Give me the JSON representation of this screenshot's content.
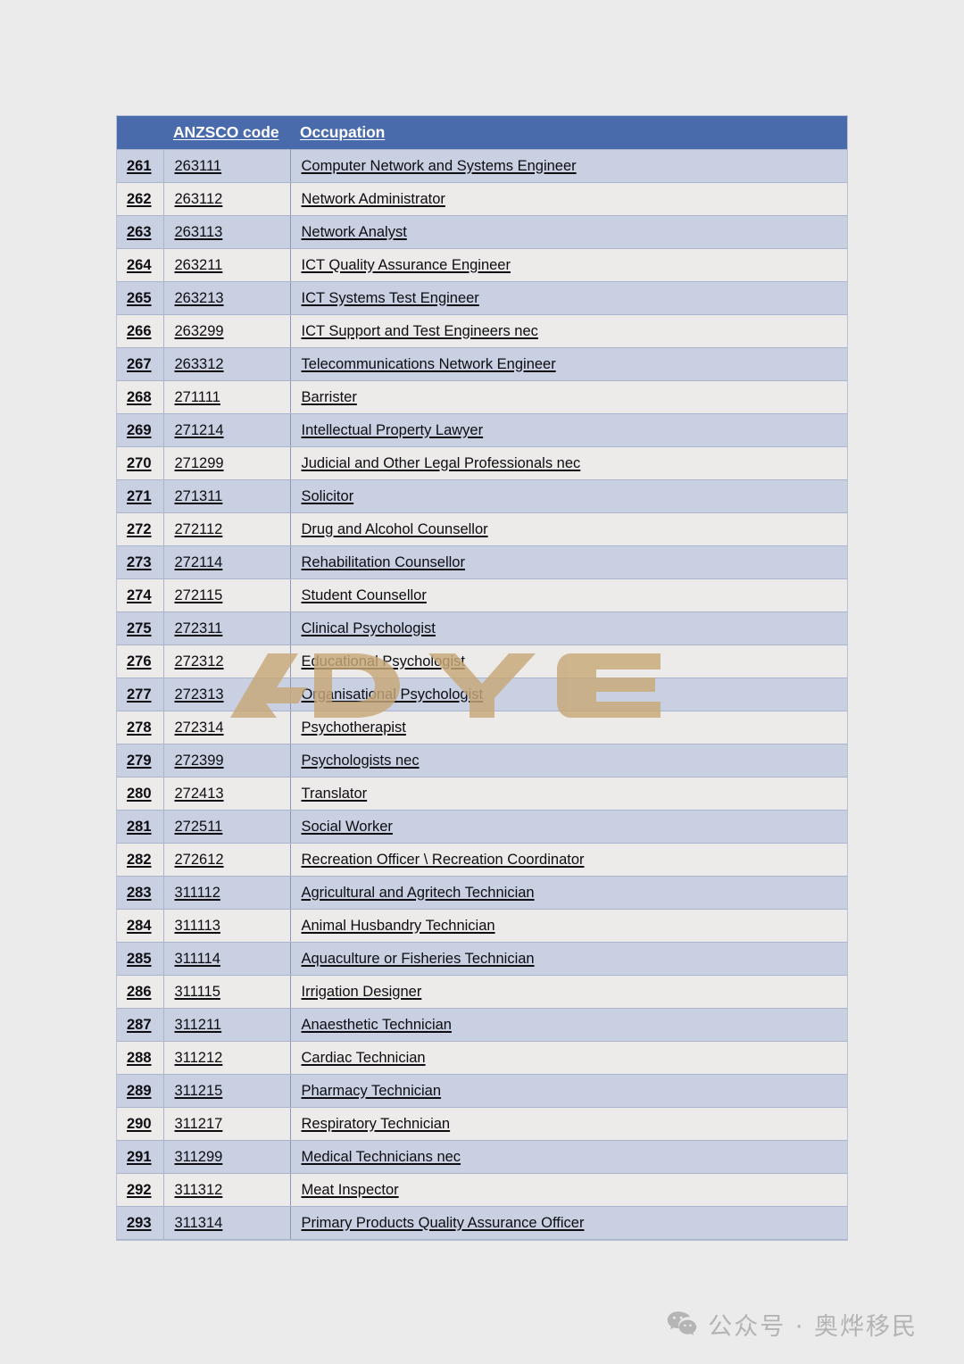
{
  "page": {
    "background_color": "#ebebeb"
  },
  "table": {
    "header_background": "#4a6bab",
    "header_text_color": "#ffffff",
    "row_odd_background": "#c8d0e2",
    "row_even_background": "#edebe9",
    "columns": {
      "index_header": "",
      "code_header": "ANZSCO code",
      "occupation_header": "Occupation"
    },
    "rows": [
      {
        "index": "261",
        "code": "263111",
        "occupation": "Computer Network and Systems Engineer"
      },
      {
        "index": "262",
        "code": "263112",
        "occupation": "Network Administrator"
      },
      {
        "index": "263",
        "code": "263113",
        "occupation": "Network Analyst"
      },
      {
        "index": "264",
        "code": "263211",
        "occupation": "ICT Quality Assurance Engineer"
      },
      {
        "index": "265",
        "code": "263213",
        "occupation": "ICT Systems Test Engineer"
      },
      {
        "index": "266",
        "code": "263299",
        "occupation": "ICT Support and Test Engineers nec"
      },
      {
        "index": "267",
        "code": "263312",
        "occupation": "Telecommunications Network Engineer"
      },
      {
        "index": "268",
        "code": "271111",
        "occupation": "Barrister"
      },
      {
        "index": "269",
        "code": "271214",
        "occupation": "Intellectual Property Lawyer"
      },
      {
        "index": "270",
        "code": "271299",
        "occupation": "Judicial and Other Legal Professionals nec"
      },
      {
        "index": "271",
        "code": "271311",
        "occupation": "Solicitor"
      },
      {
        "index": "272",
        "code": "272112",
        "occupation": "Drug and Alcohol Counsellor"
      },
      {
        "index": "273",
        "code": "272114",
        "occupation": "Rehabilitation Counsellor"
      },
      {
        "index": "274",
        "code": "272115",
        "occupation": "Student Counsellor"
      },
      {
        "index": "275",
        "code": "272311",
        "occupation": "Clinical Psychologist"
      },
      {
        "index": "276",
        "code": "272312",
        "occupation": "Educational Psychologist"
      },
      {
        "index": "277",
        "code": "272313",
        "occupation": "Organisational Psychologist"
      },
      {
        "index": "278",
        "code": "272314",
        "occupation": "Psychotherapist"
      },
      {
        "index": "279",
        "code": "272399",
        "occupation": "Psychologists nec"
      },
      {
        "index": "280",
        "code": "272413",
        "occupation": "Translator"
      },
      {
        "index": "281",
        "code": "272511",
        "occupation": "Social Worker"
      },
      {
        "index": "282",
        "code": "272612",
        "occupation": "Recreation Officer \\ Recreation Coordinator"
      },
      {
        "index": "283",
        "code": "311112",
        "occupation": "Agricultural and Agritech Technician"
      },
      {
        "index": "284",
        "code": "311113",
        "occupation": "Animal Husbandry Technician"
      },
      {
        "index": "285",
        "code": "311114",
        "occupation": "Aquaculture or Fisheries Technician"
      },
      {
        "index": "286",
        "code": "311115",
        "occupation": "Irrigation Designer"
      },
      {
        "index": "287",
        "code": "311211",
        "occupation": "Anaesthetic Technician"
      },
      {
        "index": "288",
        "code": "311212",
        "occupation": "Cardiac Technician"
      },
      {
        "index": "289",
        "code": "311215",
        "occupation": "Pharmacy Technician"
      },
      {
        "index": "290",
        "code": "311217",
        "occupation": "Respiratory Technician"
      },
      {
        "index": "291",
        "code": "311299",
        "occupation": "Medical Technicians nec"
      },
      {
        "index": "292",
        "code": "311312",
        "occupation": "Meat Inspector"
      },
      {
        "index": "293",
        "code": "311314",
        "occupation": "Primary Products Quality Assurance Officer"
      }
    ]
  },
  "watermark": {
    "text": "AOYE",
    "color": "#c8a878"
  },
  "footer": {
    "icon": "wechat-icon",
    "text": "公众号 · 奥烨移民",
    "color": "#b3b3b3"
  }
}
